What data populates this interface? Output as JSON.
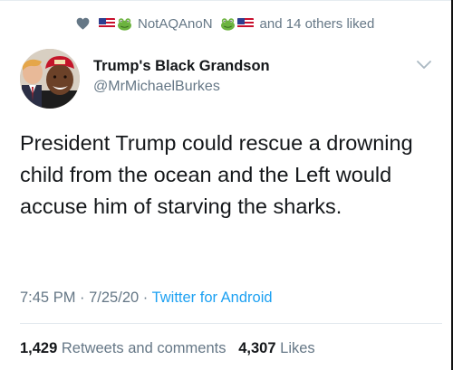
{
  "social_context": {
    "liked_by_name": "NotAQAnoN",
    "others_text": "and 14 others liked"
  },
  "author": {
    "display_name": "Trump's Black Grandson",
    "handle": "@MrMichaelBurkes"
  },
  "tweet": {
    "text": "President Trump could rescue a drowning child from the ocean and the Left would accuse him of starving the sharks."
  },
  "meta": {
    "time": "7:45 PM",
    "separator1": " · ",
    "date": "7/25/20",
    "separator2": " · ",
    "source": "Twitter for Android"
  },
  "stats": {
    "retweets_count": "1,429",
    "retweets_label": "Retweets and comments",
    "likes_count": "4,307",
    "likes_label": "Likes"
  },
  "icons": {
    "heart": "heart-icon",
    "flag": "us-flag-icon",
    "frog": "frog-emoji-icon",
    "chevron": "chevron-down-icon"
  },
  "colors": {
    "link_blue": "#1da1f2",
    "secondary_text": "#657786",
    "primary_text": "#14171a"
  }
}
